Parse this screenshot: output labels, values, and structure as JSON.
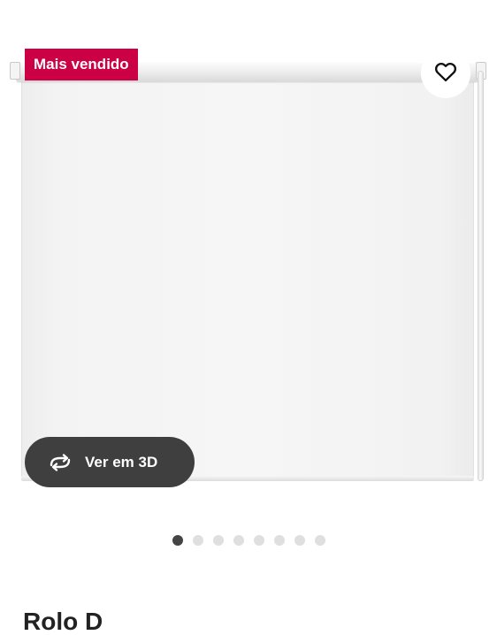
{
  "badge": {
    "label": "Mais vendido",
    "color": "#cc0044"
  },
  "favorite": {
    "icon": "heart-outline-icon"
  },
  "view3d": {
    "label": "Ver em 3D",
    "icon": "rotate-3d-icon"
  },
  "gallery": {
    "image_count": 8,
    "active_index": 0
  },
  "product": {
    "title_partial": "Rolo  D"
  }
}
